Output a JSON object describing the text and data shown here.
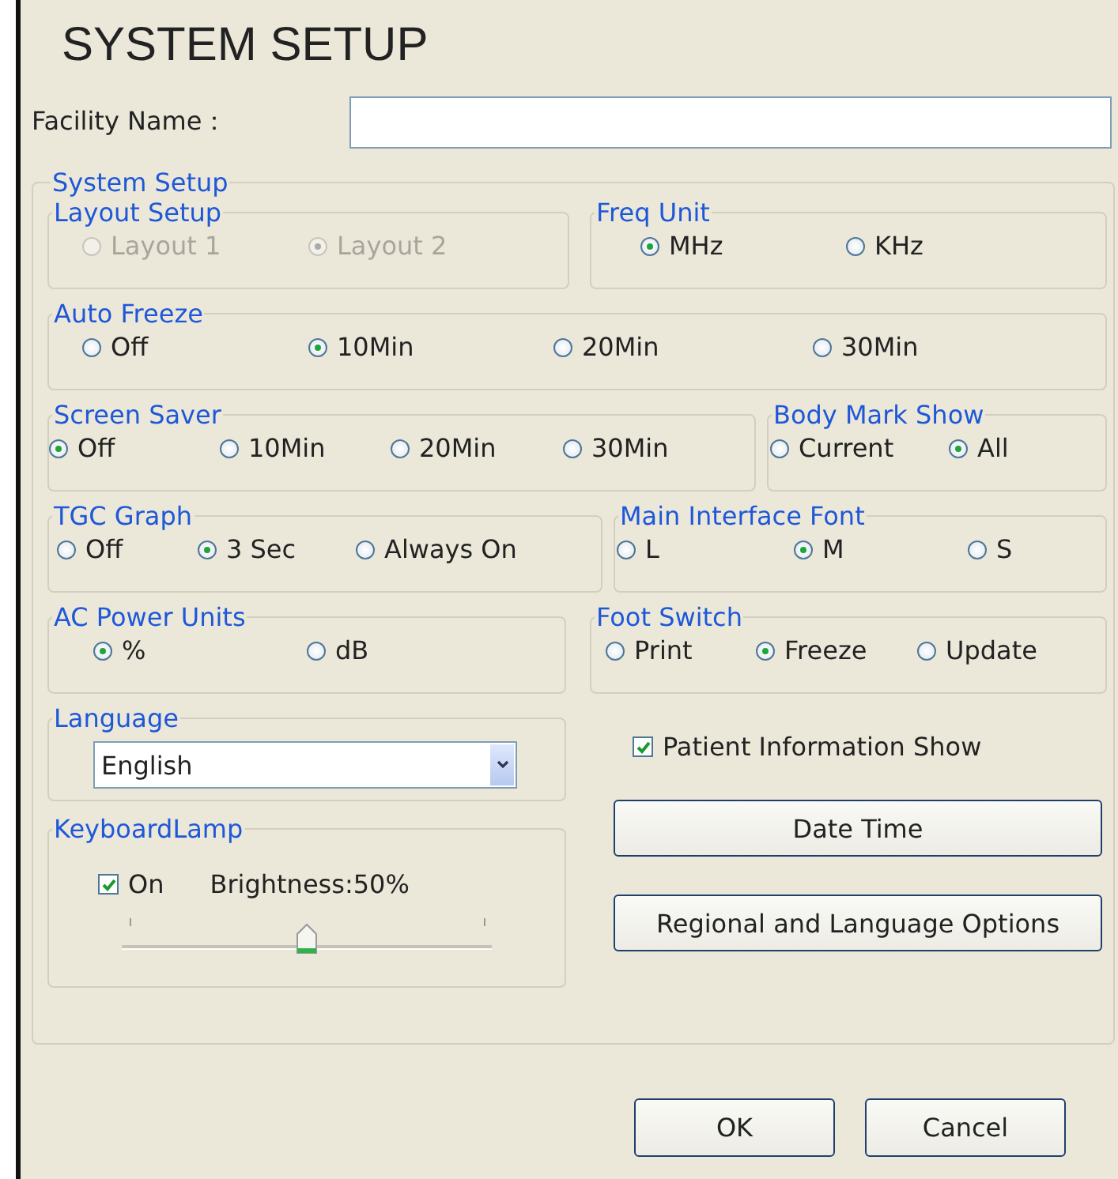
{
  "title": "SYSTEM SETUP",
  "facility": {
    "label": "Facility Name："
  },
  "system_setup": {
    "title": "System Setup",
    "groups": [
      {
        "title": "Layout Setup",
        "disabled": true,
        "options": [
          {
            "label": "Layout 1",
            "selected": false
          },
          {
            "label": "Layout 2",
            "selected": true
          }
        ]
      },
      {
        "title": "Freq Unit",
        "disabled": false,
        "options": [
          {
            "label": "MHz",
            "selected": true
          },
          {
            "label": "KHz",
            "selected": false
          }
        ]
      },
      {
        "title": "Auto Freeze",
        "disabled": false,
        "options": [
          {
            "label": "Off",
            "selected": false
          },
          {
            "label": "10Min",
            "selected": true
          },
          {
            "label": "20Min",
            "selected": false
          },
          {
            "label": "30Min",
            "selected": false
          }
        ]
      },
      {
        "title": "Screen Saver",
        "disabled": false,
        "options": [
          {
            "label": "Off",
            "selected": true
          },
          {
            "label": "10Min",
            "selected": false
          },
          {
            "label": "20Min",
            "selected": false
          },
          {
            "label": "30Min",
            "selected": false
          }
        ]
      },
      {
        "title": "Body Mark Show",
        "disabled": false,
        "options": [
          {
            "label": "Current",
            "selected": false
          },
          {
            "label": "All",
            "selected": true
          }
        ]
      },
      {
        "title": "TGC Graph",
        "disabled": false,
        "options": [
          {
            "label": "Off",
            "selected": false
          },
          {
            "label": "3 Sec",
            "selected": true
          },
          {
            "label": "Always On",
            "selected": false
          }
        ]
      },
      {
        "title": "Main Interface Font",
        "disabled": false,
        "options": [
          {
            "label": "L",
            "selected": false
          },
          {
            "label": "M",
            "selected": true
          },
          {
            "label": "S",
            "selected": false
          }
        ]
      },
      {
        "title": "AC Power Units",
        "disabled": false,
        "options": [
          {
            "label": "%",
            "selected": true
          },
          {
            "label": "dB",
            "selected": false
          }
        ]
      },
      {
        "title": "Foot Switch",
        "disabled": false,
        "options": [
          {
            "label": "Print",
            "selected": false
          },
          {
            "label": "Freeze",
            "selected": true
          },
          {
            "label": "Update",
            "selected": false
          }
        ]
      }
    ],
    "language": {
      "title": "Language",
      "value": "English"
    },
    "patient_info": {
      "label": "Patient Information Show",
      "checked": true
    },
    "keyboard_lamp": {
      "title": "KeyboardLamp",
      "on": {
        "label": "On",
        "checked": true
      },
      "brightness_label": "Brightness:50%",
      "level": 0.5
    },
    "buttons": [
      "Date Time",
      "Regional and Language Options"
    ]
  },
  "dialog_buttons": [
    "OK",
    "Cancel"
  ]
}
